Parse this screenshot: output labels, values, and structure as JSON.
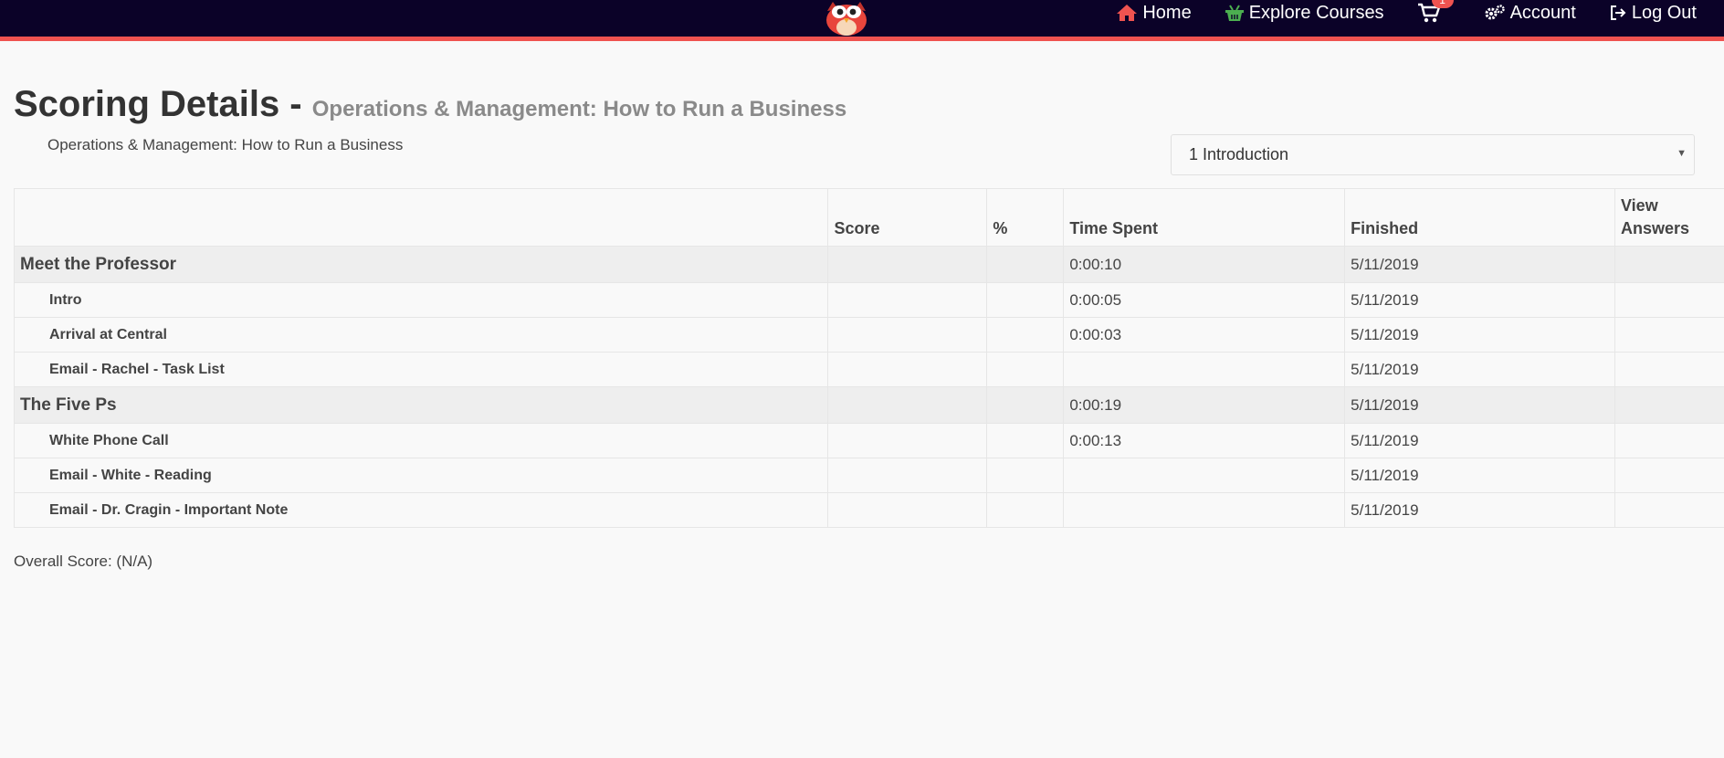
{
  "nav": {
    "items": [
      {
        "label": "Home",
        "icon": "home-icon",
        "color": "#ef5350"
      },
      {
        "label": "Explore Courses",
        "icon": "basket-icon",
        "color": "#4caf50"
      },
      {
        "label": "",
        "icon": "cart-icon",
        "color": "#ffffff",
        "badge": "1"
      },
      {
        "label": "Account",
        "icon": "gears-icon",
        "color": "#ffffff"
      },
      {
        "label": "Log Out",
        "icon": "logout-icon",
        "color": "#ffffff"
      }
    ]
  },
  "page": {
    "title": "Scoring Details -",
    "subtitle": "Operations & Management: How to Run a Business",
    "course_name": "Operations & Management: How to Run a Business",
    "section_select": "1 Introduction",
    "overall_score": "Overall Score: (N/A)"
  },
  "table": {
    "headers": [
      "",
      "Score",
      "%",
      "Time Spent",
      "Finished",
      "View Answers"
    ],
    "rows": [
      {
        "type": "group",
        "title": "Meet the Professor",
        "score": "",
        "pct": "",
        "time": "0:00:10",
        "finished": "5/11/2019",
        "view": ""
      },
      {
        "type": "item",
        "title": "Intro",
        "score": "",
        "pct": "",
        "time": "0:00:05",
        "finished": "5/11/2019",
        "view": ""
      },
      {
        "type": "item",
        "title": "Arrival at Central",
        "score": "",
        "pct": "",
        "time": "0:00:03",
        "finished": "5/11/2019",
        "view": ""
      },
      {
        "type": "item",
        "title": "Email - Rachel - Task List",
        "score": "",
        "pct": "",
        "time": "",
        "finished": "5/11/2019",
        "view": ""
      },
      {
        "type": "group",
        "title": "The Five Ps",
        "score": "",
        "pct": "",
        "time": "0:00:19",
        "finished": "5/11/2019",
        "view": ""
      },
      {
        "type": "item",
        "title": "White Phone Call",
        "score": "",
        "pct": "",
        "time": "0:00:13",
        "finished": "5/11/2019",
        "view": ""
      },
      {
        "type": "item",
        "title": "Email - White - Reading",
        "score": "",
        "pct": "",
        "time": "",
        "finished": "5/11/2019",
        "view": ""
      },
      {
        "type": "item",
        "title": "Email - Dr. Cragin - Important Note",
        "score": "",
        "pct": "",
        "time": "",
        "finished": "5/11/2019",
        "view": ""
      }
    ]
  },
  "colors": {
    "navbar": "#0b0228",
    "accent": "#ef5350",
    "group_row": "#eeeeee"
  }
}
